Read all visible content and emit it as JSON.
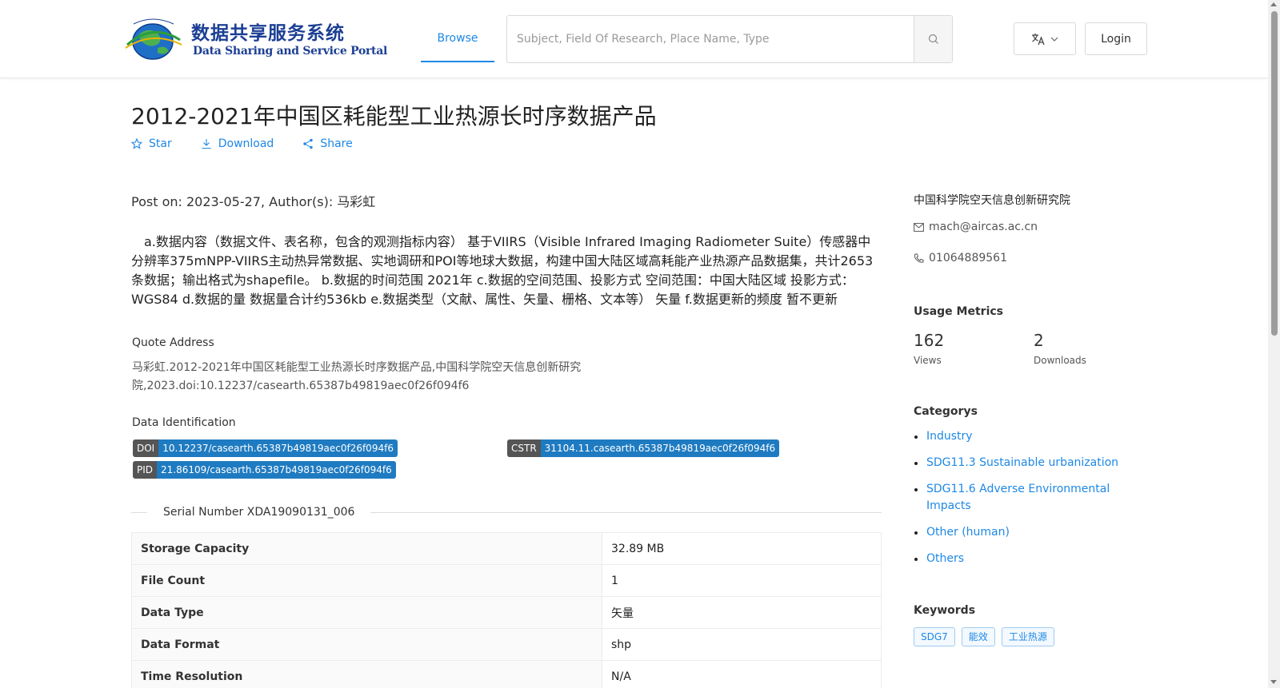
{
  "header": {
    "logo_cn": "数据共享服务系统",
    "logo_en": "Data Sharing and Service Portal",
    "nav_browse": "Browse",
    "search_placeholder": "Subject, Field Of Research, Place Name, Type",
    "login_label": "Login"
  },
  "dataset": {
    "title": "2012-2021年中国区耗能型工业热源长时序数据产品",
    "actions": {
      "star": "Star",
      "download": "Download",
      "share": "Share"
    },
    "post_meta": "Post on: 2023-05-27, Author(s): 马彩虹",
    "description": "a.数据内容（数据文件、表名称，包含的观测指标内容） 基于VIIRS（Visible Infrared Imaging Radiometer Suite）传感器中分辨率375mNPP-VIIRS主动热异常数据、实地调研和POI等地球大数据，构建中国大陆区域高耗能产业热源产品数据集，共计2653条数据；输出格式为shapefile。 b.数据的时间范围 2021年 c.数据的空间范围、投影方式 空间范围：中国大陆区域 投影方式：WGS84 d.数据的量 数据量合计约536kb e.数据类型（文献、属性、矢量、栅格、文本等） 矢量 f.数据更新的频度 暂不更新",
    "quote_label": "Quote Address",
    "quote_text": "马彩虹.2012-2021年中国区耗能型工业热源长时序数据产品,中国科学院空天信息创新研究院,2023.doi:10.12237/casearth.65387b49819aec0f26f094f6",
    "identification_label": "Data Identification",
    "identifiers": {
      "doi": {
        "key": "DOI",
        "value": "10.12237/casearth.65387b49819aec0f26f094f6"
      },
      "cstr": {
        "key": "CSTR",
        "value": "31104.11.casearth.65387b49819aec0f26f094f6"
      },
      "pid": {
        "key": "PID",
        "value": "21.86109/casearth.65387b49819aec0f26f094f6"
      }
    },
    "serial_number": "Serial Number XDA19090131_006",
    "info_rows": [
      {
        "key": "Storage Capacity",
        "value": "32.89 MB"
      },
      {
        "key": "File Count",
        "value": "1"
      },
      {
        "key": "Data Type",
        "value": "矢量"
      },
      {
        "key": "Data Format",
        "value": "shp"
      },
      {
        "key": "Time Resolution",
        "value": "N/A"
      }
    ]
  },
  "sidebar": {
    "organization": "中国科学院空天信息创新研究院",
    "email": "mach@aircas.ac.cn",
    "phone": "01064889561",
    "usage_heading": "Usage Metrics",
    "views_count": "162",
    "views_label": "Views",
    "downloads_count": "2",
    "downloads_label": "Downloads",
    "categories_heading": "Categorys",
    "categories": [
      "Industry",
      "SDG11.3 Sustainable urbanization",
      "SDG11.6 Adverse Environmental Impacts",
      "Other (human)",
      "Others"
    ],
    "keywords_heading": "Keywords",
    "keywords": [
      "SDG7",
      "能效",
      "工业热源"
    ]
  },
  "colors": {
    "accent": "#1e88e5",
    "logo_blue": "#1c3f94",
    "badge_key": "#555555",
    "badge_value": "#1f7bc1"
  },
  "icons": [
    "globe-logo-icon",
    "search-icon",
    "translate-icon",
    "chevron-down-icon",
    "star-icon",
    "download-icon",
    "share-icon",
    "mail-icon",
    "phone-icon"
  ]
}
